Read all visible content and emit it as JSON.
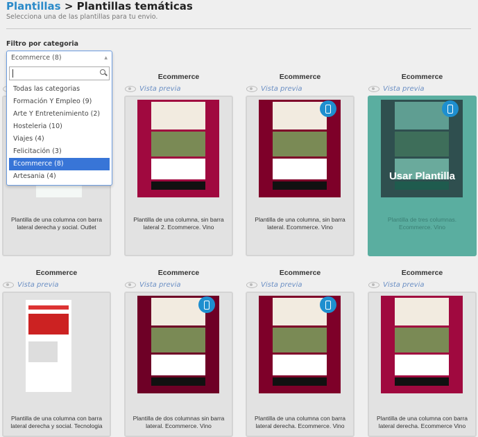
{
  "header": {
    "breadcrumb_link": "Plantillas",
    "separator": " > ",
    "title": "Plantillas temáticas",
    "subtitle": "Selecciona una de las plantillas para tu envio."
  },
  "filter": {
    "label": "Filtro por categoria",
    "selected": "Ecommerce (8)",
    "search_value": "",
    "options": [
      "Todas las categorias",
      "Formación Y Empleo (9)",
      "Arte Y Entretenimiento (2)",
      "Hosteleria (10)",
      "Viajes (4)",
      "Felicitación (3)",
      "Ecommerce (8)",
      "Artesania (4)"
    ],
    "active_index": 6
  },
  "preview_label": "Vista previa",
  "use_label": "Usar Plantilla",
  "templates": [
    {
      "category": "Ecommerce",
      "desc": "Plantilla de una columna con barra lateral derecha y social. Outlet",
      "mobile": false
    },
    {
      "category": "Ecommerce",
      "desc": "Plantilla de una columna, sin barra lateral 2. Ecommerce. Vino",
      "mobile": false
    },
    {
      "category": "Ecommerce",
      "desc": "Plantilla de una columna, sin barra lateral. Ecommerce. Vino",
      "mobile": true
    },
    {
      "category": "Ecommerce",
      "desc": "Plantilla de tres columnas. Ecommerce. Vino",
      "mobile": true,
      "hovered": true
    },
    {
      "category": "Ecommerce",
      "desc": "Plantilla de una columna con barra lateral derecha y social. Tecnologia",
      "mobile": false
    },
    {
      "category": "Ecommerce",
      "desc": "Plantilla de dos columnas sin barra lateral. Ecommerce. Vino",
      "mobile": true
    },
    {
      "category": "Ecommerce",
      "desc": "Plantilla de una columna con barra lateral derecha. Ecommerce. Vino",
      "mobile": true
    },
    {
      "category": "Ecommerce",
      "desc": "Plantilla de una columna con barra lateral derecha. Ecommerce Vino",
      "mobile": false
    }
  ],
  "colors": {
    "accent": "#2a8ac9",
    "selected_option": "#3875d7",
    "hover_overlay": "#5aaea0",
    "wine": "#a0093f",
    "mobile_badge": "#1e8fcf"
  }
}
